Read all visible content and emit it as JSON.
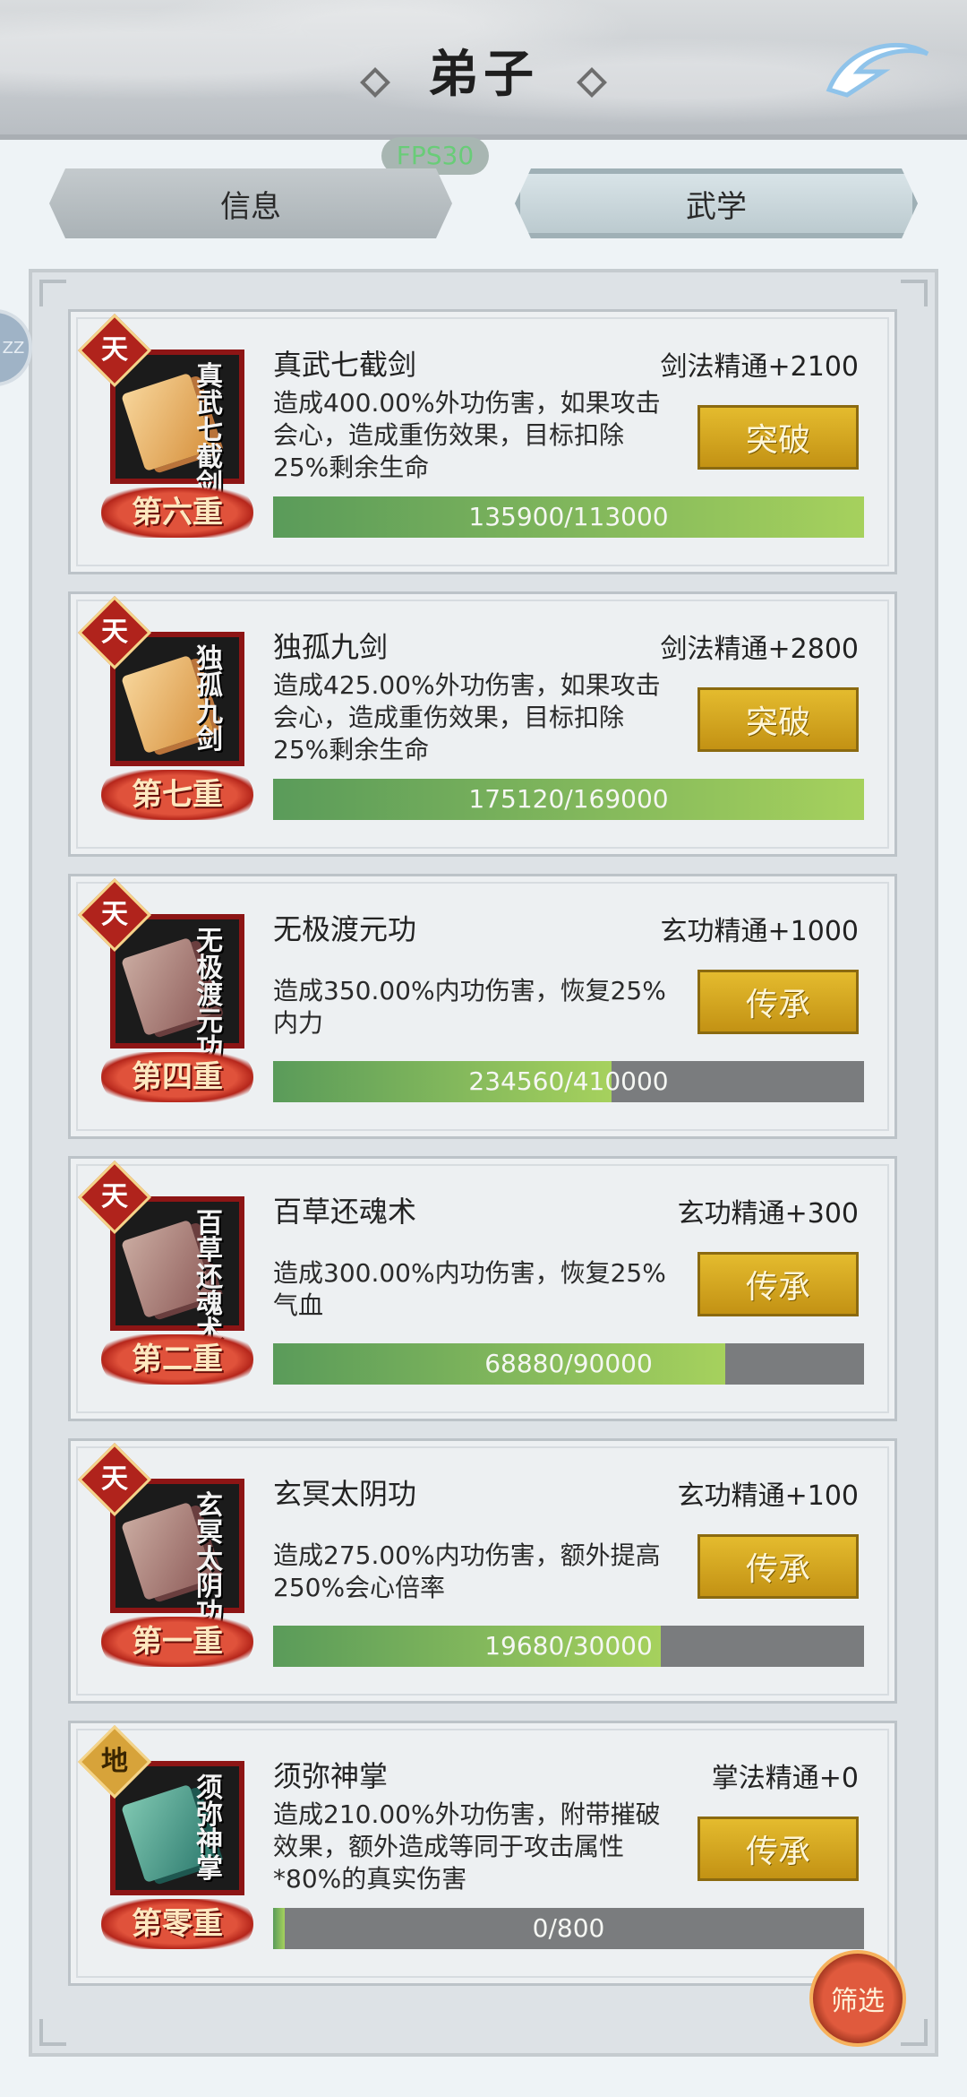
{
  "header": {
    "title": "弟子"
  },
  "overlay": {
    "fps": "FPS30"
  },
  "tabs": [
    {
      "label": "信息"
    },
    {
      "label": "武学"
    }
  ],
  "side_tab": {
    "label": "ZZ"
  },
  "skills": [
    {
      "grade": "天",
      "icon_label": "真武七截剑",
      "name": "真武七截剑",
      "mastery": "剑法精通+2100",
      "desc": "造成400.00%外功伤害，如果攻击会心，造成重伤效果，目标扣除25%剩余生命",
      "action": "突破",
      "layer": "第六重",
      "progress_text": "135900/113000",
      "progress": 1.0
    },
    {
      "grade": "天",
      "icon_label": "独孤九剑",
      "name": "独孤九剑",
      "mastery": "剑法精通+2800",
      "desc": "造成425.00%外功伤害，如果攻击会心，造成重伤效果，目标扣除25%剩余生命",
      "action": "突破",
      "layer": "第七重",
      "progress_text": "175120/169000",
      "progress": 1.0
    },
    {
      "grade": "天",
      "icon_label": "无极渡元功",
      "name": "无极渡元功",
      "mastery": "玄功精通+1000",
      "desc": "造成350.00%内功伤害，恢复25%内力",
      "action": "传承",
      "layer": "第四重",
      "progress_text": "234560/410000",
      "progress": 0.572
    },
    {
      "grade": "天",
      "icon_label": "百草还魂术",
      "name": "百草还魂术",
      "mastery": "玄功精通+300",
      "desc": "造成300.00%内功伤害，恢复25%气血",
      "action": "传承",
      "layer": "第二重",
      "progress_text": "68880/90000",
      "progress": 0.765
    },
    {
      "grade": "天",
      "icon_label": "玄冥太阴功",
      "name": "玄冥太阴功",
      "mastery": "玄功精通+100",
      "desc": "造成275.00%内功伤害，额外提高250%会心倍率",
      "action": "传承",
      "layer": "第一重",
      "progress_text": "19680/30000",
      "progress": 0.656
    },
    {
      "grade": "地",
      "icon_label": "须弥神掌",
      "name": "须弥神掌",
      "mastery": "掌法精通+0",
      "desc": "造成210.00%外功伤害，附带摧破效果，额外造成等同于攻击属性*80%的真实伤害",
      "action": "传承",
      "layer": "第零重",
      "progress_text": "0/800",
      "progress": 0.02
    }
  ],
  "filter": {
    "label": "筛选"
  }
}
